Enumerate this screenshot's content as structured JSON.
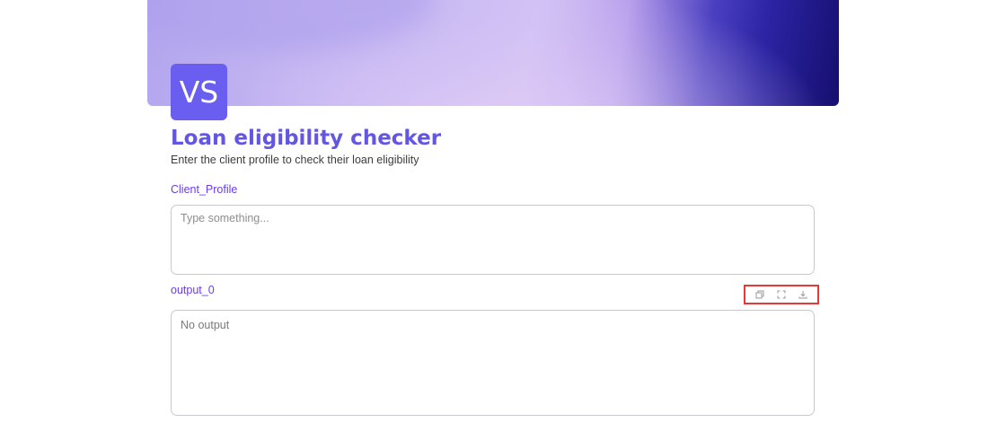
{
  "app": {
    "avatar_initials": "VS",
    "title": "Loan eligibility checker",
    "description": "Enter the client profile to check their loan eligibility"
  },
  "colors": {
    "accent": "#6356e4",
    "label": "#6b3ee6",
    "toolbar_highlight": "#e53935"
  },
  "inputs": {
    "client_profile": {
      "label": "Client_Profile",
      "placeholder": "Type something...",
      "value": ""
    }
  },
  "outputs": {
    "output_0": {
      "label": "output_0",
      "value": "No output"
    }
  },
  "output_toolbar": {
    "icons": [
      "copy-icon",
      "expand-icon",
      "download-icon"
    ]
  }
}
